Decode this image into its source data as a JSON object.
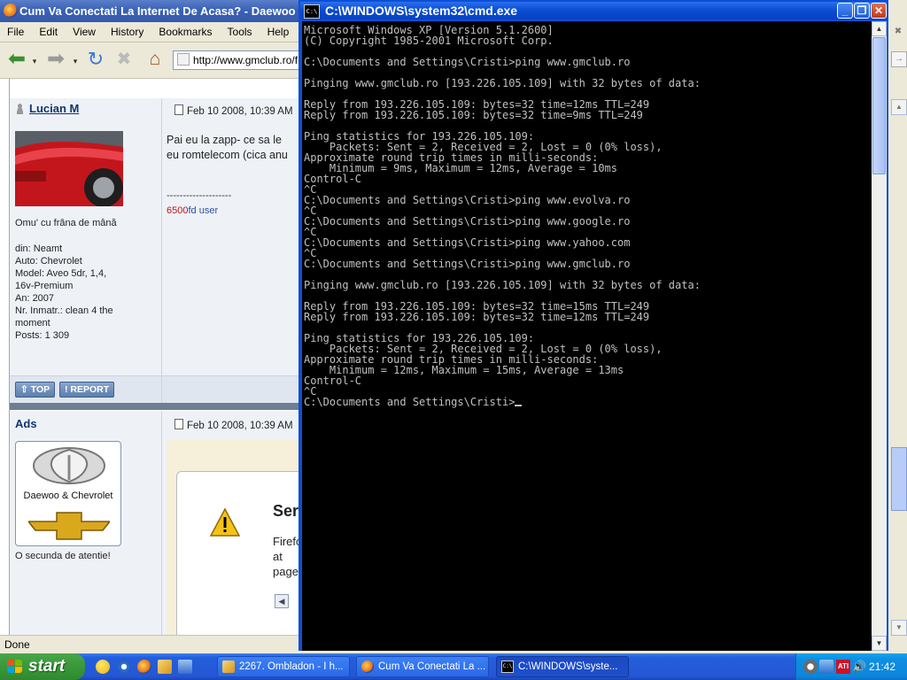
{
  "firefox": {
    "title": "Cum Va Conectati La Internet De Acasa? - Daewoo &",
    "menu": [
      "File",
      "Edit",
      "View",
      "History",
      "Bookmarks",
      "Tools",
      "Help"
    ],
    "url": "http://www.gmclub.ro/f",
    "status": "Done"
  },
  "post1": {
    "author": "Lucian M",
    "date": "Feb 10 2008, 10:39 AM",
    "text_lines": [
      "Pai eu la zapp- ce sa le",
      "eu romtelecom (cica anu"
    ],
    "signature_divider": "--------------------",
    "signature_num": "6500",
    "signature_rest": "fd user",
    "motto": "Omu' cu frâna de mână",
    "info": [
      "din: Neamt",
      "Auto: Chevrolet",
      "Model: Aveo 5dr, 1,4,",
      "16v-Premium",
      "An: 2007",
      "Nr. Inmatr.: clean 4 the",
      "moment",
      "Posts: 1 309"
    ],
    "btn_top": "TOP",
    "btn_report": "REPORT"
  },
  "post2": {
    "author": "Ads",
    "date": "Feb 10 2008, 10:39 AM",
    "ad_label": "Daewoo & Chevrolet",
    "note": "O secunda de atentie!",
    "dialog_title": "Ser",
    "dialog_lines": [
      "Firefo",
      "at",
      "page"
    ]
  },
  "cmd": {
    "title": "C:\\WINDOWS\\system32\\cmd.exe",
    "lines": [
      "Microsoft Windows XP [Version 5.1.2600]",
      "(C) Copyright 1985-2001 Microsoft Corp.",
      "",
      "C:\\Documents and Settings\\Cristi>ping www.gmclub.ro",
      "",
      "Pinging www.gmclub.ro [193.226.105.109] with 32 bytes of data:",
      "",
      "Reply from 193.226.105.109: bytes=32 time=12ms TTL=249",
      "Reply from 193.226.105.109: bytes=32 time=9ms TTL=249",
      "",
      "Ping statistics for 193.226.105.109:",
      "    Packets: Sent = 2, Received = 2, Lost = 0 (0% loss),",
      "Approximate round trip times in milli-seconds:",
      "    Minimum = 9ms, Maximum = 12ms, Average = 10ms",
      "Control-C",
      "^C",
      "C:\\Documents and Settings\\Cristi>ping www.evolva.ro",
      "^C",
      "C:\\Documents and Settings\\Cristi>ping www.google.ro",
      "^C",
      "C:\\Documents and Settings\\Cristi>ping www.yahoo.com",
      "^C",
      "C:\\Documents and Settings\\Cristi>ping www.gmclub.ro",
      "",
      "Pinging www.gmclub.ro [193.226.105.109] with 32 bytes of data:",
      "",
      "Reply from 193.226.105.109: bytes=32 time=15ms TTL=249",
      "Reply from 193.226.105.109: bytes=32 time=12ms TTL=249",
      "",
      "Ping statistics for 193.226.105.109:",
      "    Packets: Sent = 2, Received = 2, Lost = 0 (0% loss),",
      "Approximate round trip times in milli-seconds:",
      "    Minimum = 12ms, Maximum = 15ms, Average = 13ms",
      "Control-C",
      "^C",
      "C:\\Documents and Settings\\Cristi>"
    ]
  },
  "taskbar": {
    "start": "start",
    "tasks": [
      {
        "label": "2267. Ombladon - I h...",
        "icon": "winamp-icon"
      },
      {
        "label": "Cum Va Conectati La ...",
        "icon": "firefox-icon"
      },
      {
        "label": "C:\\WINDOWS\\syste...",
        "icon": "cmd-icon"
      }
    ],
    "clock": "21:42"
  },
  "colors": {
    "xp_blue": "#245edb",
    "console_text": "#c0c0c0",
    "start_green": "#3c9a3c"
  }
}
